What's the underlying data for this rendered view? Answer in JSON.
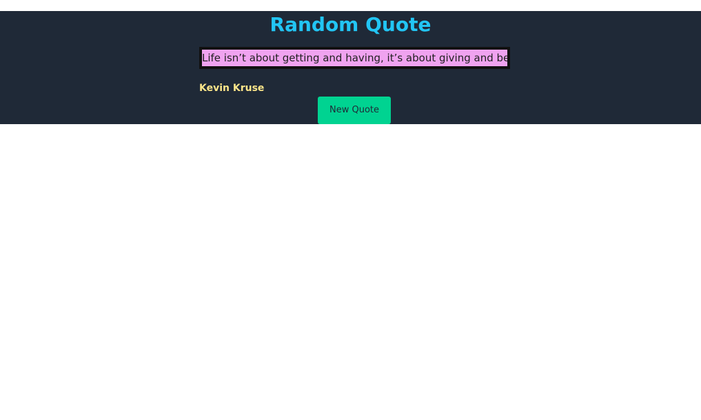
{
  "header": {
    "title": "Random Quote"
  },
  "quote": {
    "text": "Life isn’t about getting and having, it’s about giving and being.",
    "author": "Kevin Kruse"
  },
  "actions": {
    "new_quote_label": "New Quote"
  },
  "colors": {
    "header_background": "#1f2937",
    "title": "#22c5f4",
    "quote_highlight": "#f0a3f0",
    "author": "#fde68a",
    "button": "#00d391"
  }
}
